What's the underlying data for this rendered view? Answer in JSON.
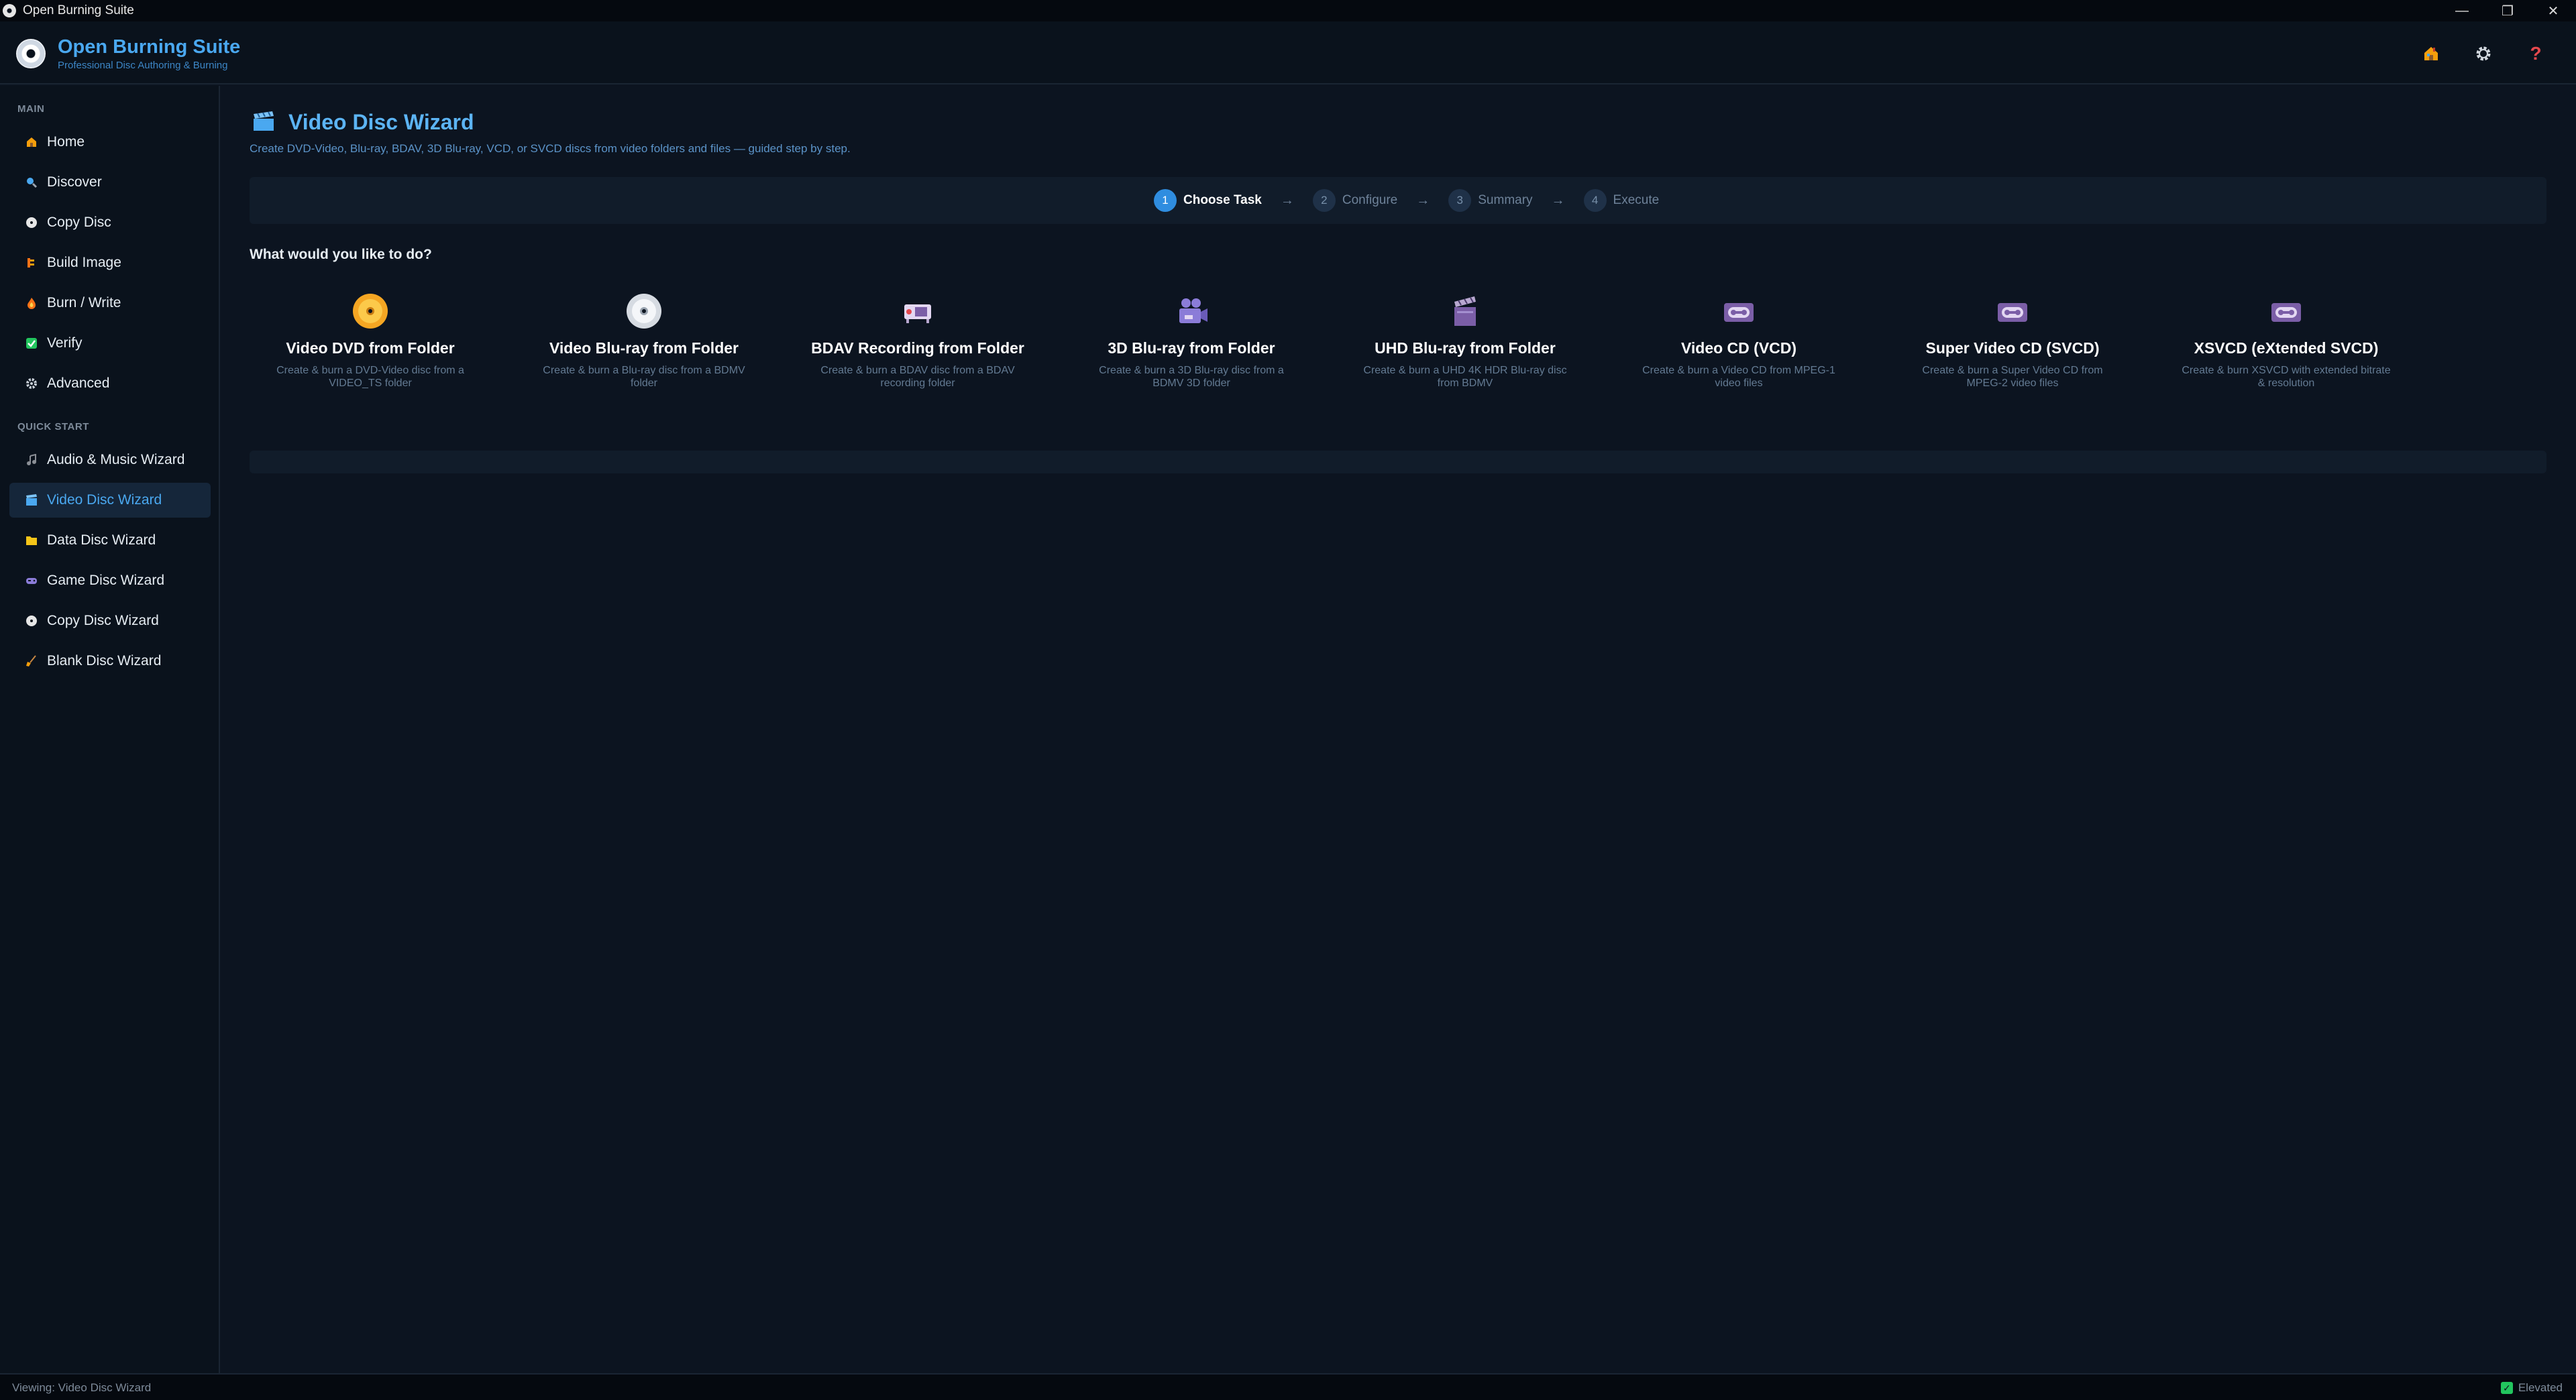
{
  "window": {
    "title": "Open Burning Suite"
  },
  "header": {
    "app_name": "Open Burning Suite",
    "tagline": "Professional Disc Authoring & Burning",
    "icons": [
      "home-icon",
      "gear-icon",
      "help-icon"
    ],
    "help_glyph": "?"
  },
  "sidebar": {
    "main_label": "MAIN",
    "main_items": [
      {
        "label": "Home",
        "icon": "home-icon"
      },
      {
        "label": "Discover",
        "icon": "search-icon"
      },
      {
        "label": "Copy Disc",
        "icon": "disc-icon"
      },
      {
        "label": "Build Image",
        "icon": "build-icon"
      },
      {
        "label": "Burn / Write",
        "icon": "flame-icon"
      },
      {
        "label": "Verify",
        "icon": "check-icon"
      },
      {
        "label": "Advanced",
        "icon": "gear-icon"
      }
    ],
    "quick_label": "QUICK START",
    "quick_items": [
      {
        "label": "Audio & Music Wizard",
        "icon": "music-note-icon"
      },
      {
        "label": "Video Disc Wizard",
        "icon": "clapperboard-icon",
        "active": true
      },
      {
        "label": "Data Disc Wizard",
        "icon": "folder-icon"
      },
      {
        "label": "Game Disc Wizard",
        "icon": "gamepad-icon"
      },
      {
        "label": "Copy Disc Wizard",
        "icon": "disc-icon"
      },
      {
        "label": "Blank Disc Wizard",
        "icon": "broom-icon"
      }
    ]
  },
  "main": {
    "title": "Video Disc Wizard",
    "description": "Create DVD-Video, Blu-ray, BDAV, 3D Blu-ray, VCD, or SVCD discs from video folders and files — guided step by step.",
    "steps": [
      {
        "num": "1",
        "label": "Choose Task",
        "active": true
      },
      {
        "num": "2",
        "label": "Configure"
      },
      {
        "num": "3",
        "label": "Summary"
      },
      {
        "num": "4",
        "label": "Execute"
      }
    ],
    "prompt": "What would you like to do?",
    "tasks": [
      {
        "title": "Video DVD from Folder",
        "desc": "Create & burn a DVD-Video disc from a VIDEO_TS folder",
        "icon": "dvd-icon"
      },
      {
        "title": "Video Blu-ray from Folder",
        "desc": "Create & burn a Blu-ray disc from a BDMV folder",
        "icon": "bluray-disc-icon"
      },
      {
        "title": "BDAV Recording from Folder",
        "desc": "Create & burn a BDAV disc from a BDAV recording folder",
        "icon": "projector-icon"
      },
      {
        "title": "3D Blu-ray from Folder",
        "desc": "Create & burn a 3D Blu-ray disc from a BDMV 3D folder",
        "icon": "movie-camera-icon"
      },
      {
        "title": "UHD Blu-ray from Folder",
        "desc": "Create & burn a UHD 4K HDR Blu-ray disc from BDMV",
        "icon": "clapperboard-icon"
      },
      {
        "title": "Video CD (VCD)",
        "desc": "Create & burn a Video CD from MPEG-1 video files",
        "icon": "videocassette-icon"
      },
      {
        "title": "Super Video CD (SVCD)",
        "desc": "Create & burn a Super Video CD from MPEG-2 video files",
        "icon": "videocassette-icon"
      },
      {
        "title": "XSVCD (eXtended SVCD)",
        "desc": "Create & burn XSVCD with extended bitrate & resolution",
        "icon": "videocassette-icon"
      }
    ]
  },
  "status": {
    "viewing": "Viewing: Video Disc Wizard",
    "elevated": "Elevated"
  },
  "colors": {
    "accent": "#4aa8f0",
    "background": "#0c1420",
    "panel": "#111c2a",
    "success": "#22c55e"
  }
}
